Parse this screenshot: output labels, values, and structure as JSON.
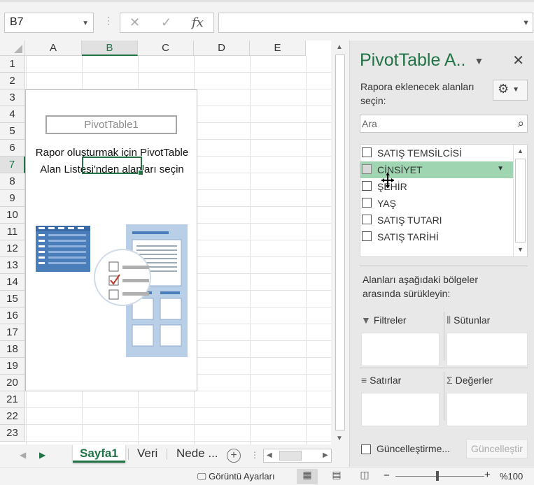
{
  "name_box": {
    "value": "B7"
  },
  "formula_bar": {
    "fx_label": "fx",
    "cancel_icon": "✕",
    "enter_icon": "✓",
    "value": ""
  },
  "grid": {
    "columns": [
      "A",
      "B",
      "C",
      "D",
      "E"
    ],
    "selected_column": "B",
    "rows": [
      "1",
      "2",
      "3",
      "4",
      "5",
      "6",
      "7",
      "8",
      "9",
      "10",
      "11",
      "12",
      "13",
      "14",
      "15",
      "16",
      "17",
      "18",
      "19",
      "20",
      "21",
      "22",
      "23"
    ],
    "selected_row": "7"
  },
  "pivot_placeholder": {
    "title": "PivotTable1",
    "message_line1": "Rapor oluşturmak için PivotTable",
    "message_line2": "Alan Listesi'nden alanları seçin"
  },
  "sheet_tabs": [
    {
      "label": "Sayfa1",
      "active": true
    },
    {
      "label": "Veri",
      "active": false
    },
    {
      "label": "Nede ...",
      "active": false
    }
  ],
  "status_bar": {
    "display_settings": "Görüntü Ayarları",
    "zoom": "%100",
    "zoom_minus": "−",
    "zoom_plus": "+"
  },
  "pivot_pane": {
    "title": "PivotTable A..",
    "subtitle": "Rapora eklenecek alanları seçin:",
    "search_placeholder": "Ara",
    "fields": [
      {
        "label": "SATIŞ TEMSİLCİSİ",
        "checked": false,
        "highlighted": false
      },
      {
        "label": "CİNSİYET",
        "checked": false,
        "highlighted": true
      },
      {
        "label": "ŞEHİR",
        "checked": false,
        "highlighted": false
      },
      {
        "label": "YAŞ",
        "checked": false,
        "highlighted": false
      },
      {
        "label": "SATIŞ TUTARI",
        "checked": false,
        "highlighted": false
      },
      {
        "label": "SATIŞ TARİHİ",
        "checked": false,
        "highlighted": false
      }
    ],
    "drag_help": "Alanları aşağıdaki bölgeler arasında sürükleyin:",
    "areas": {
      "filters": "Filtreler",
      "columns": "Sütunlar",
      "rows": "Satırlar",
      "values": "Değerler"
    },
    "defer_label": "Güncelleştirme...",
    "update_button": "Güncelleştir"
  },
  "colors": {
    "accent": "#217346",
    "highlight": "#9fd5b0",
    "illustration_blue": "#4a7ebb"
  }
}
